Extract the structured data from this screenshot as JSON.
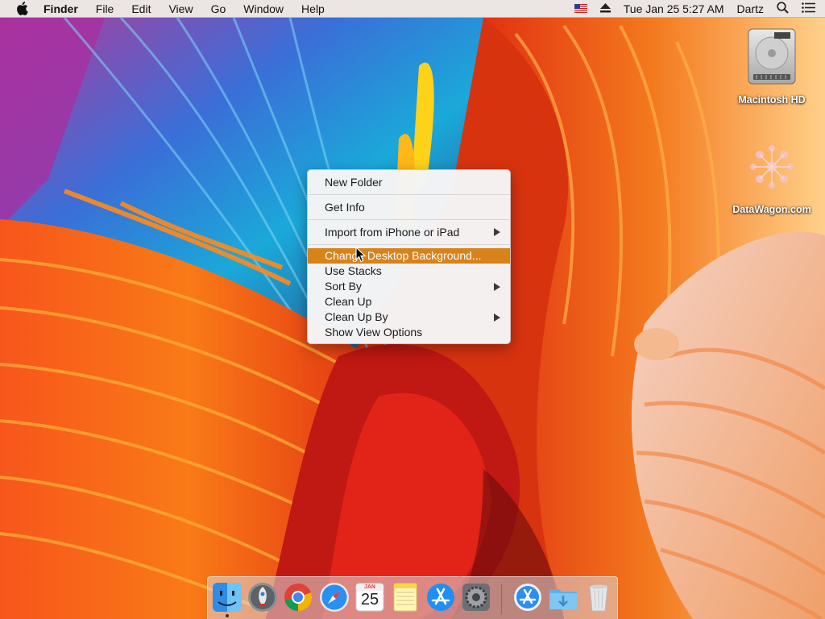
{
  "menubar": {
    "app_name": "Finder",
    "menus": [
      "File",
      "Edit",
      "View",
      "Go",
      "Window",
      "Help"
    ],
    "clock": "Tue Jan 25  5:27 AM",
    "user": "Dartz",
    "icons": [
      "apple-logo-icon",
      "us-flag-icon",
      "eject-icon",
      "spotlight-search-icon",
      "notification-center-icon"
    ]
  },
  "desktop": {
    "icons": [
      {
        "label": "Macintosh HD",
        "icon": "hard-drive-icon"
      },
      {
        "label": "DataWagon.com",
        "icon": "network-share-icon"
      }
    ]
  },
  "context_menu": {
    "items": [
      {
        "label": "New Folder"
      },
      {
        "label": "Get Info"
      },
      {
        "label": "Import from iPhone or iPad",
        "submenu": true
      },
      {
        "label": "Change Desktop Background...",
        "highlighted": true
      },
      {
        "label": "Use Stacks"
      },
      {
        "label": "Sort By",
        "submenu": true
      },
      {
        "label": "Clean Up"
      },
      {
        "label": "Clean Up By",
        "submenu": true
      },
      {
        "label": "Show View Options"
      }
    ],
    "highlight_color": "#d8821a"
  },
  "dock": {
    "apps": [
      "finder-icon",
      "launchpad-icon",
      "chrome-icon",
      "safari-icon",
      "calendar-icon",
      "notes-icon",
      "app-store-icon",
      "system-preferences-icon"
    ],
    "calendar_month": "JAN",
    "calendar_day": "25",
    "right_items": [
      "applications-folder-icon",
      "downloads-folder-icon",
      "trash-icon"
    ]
  }
}
